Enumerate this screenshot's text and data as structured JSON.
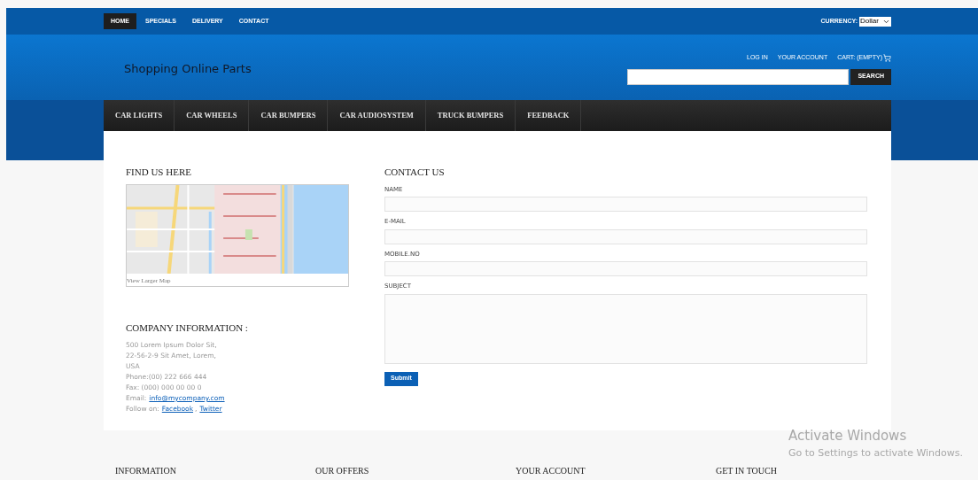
{
  "top_nav": [
    {
      "label": "HOME",
      "selected": true
    },
    {
      "label": "SPECIALS",
      "selected": false
    },
    {
      "label": "DELIVERY",
      "selected": false
    },
    {
      "label": "CONTACT",
      "selected": false
    }
  ],
  "currency": {
    "label": "CURRENCY:",
    "value": "Dollar"
  },
  "site_title": "Shopping Online Parts",
  "account_links": [
    "LOG IN",
    "YOUR ACCOUNT",
    "CART: (EMPTY)"
  ],
  "search": {
    "button": "SEARCH"
  },
  "category_menu": [
    "CAR LIGHTS",
    "CAR WHEELS",
    "CAR BUMPERS",
    "CAR AUDIOSYSTEM",
    "TRUCK BUMPERS",
    "FEEDBACK"
  ],
  "find_us": {
    "heading": "FIND US HERE",
    "link": "View Larger Map"
  },
  "company_info": {
    "heading": "COMPANY INFORMATION :",
    "address": [
      "500 Lorem Ipsum Dolor Sit,",
      "22-56-2-9 Sit Amet, Lorem,",
      "USA"
    ],
    "phone": "Phone:(00) 222 666 444",
    "fax": "Fax: (000) 000 00 00 0",
    "email": {
      "label": "Email:",
      "link": "info@mycompany.com"
    },
    "follow": {
      "label": "Follow on:",
      "links": [
        "Facebook",
        "Twitter"
      ],
      "separator": ","
    }
  },
  "contact_form": {
    "heading": "CONTACT US",
    "fields": [
      {
        "label": "NAME",
        "kind": "input"
      },
      {
        "label": "E-MAIL",
        "kind": "input"
      },
      {
        "label": "MOBILE.NO",
        "kind": "input"
      },
      {
        "label": "SUBJECT",
        "kind": "textarea"
      }
    ],
    "submit": "Submit"
  },
  "footer_headings": [
    "INFORMATION",
    "OUR OFFERS",
    "YOUR ACCOUNT",
    "GET IN TOUCH"
  ],
  "os_notice": {
    "title": "Activate Windows",
    "text": "Go to Settings to activate Windows."
  }
}
